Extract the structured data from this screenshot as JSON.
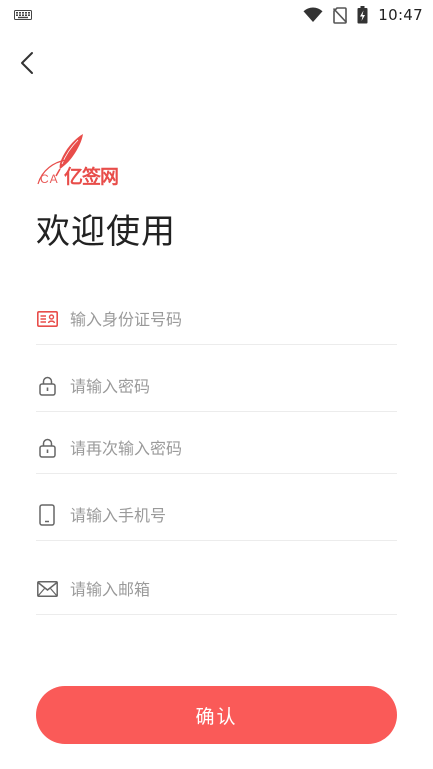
{
  "status_bar": {
    "time": "10:47",
    "icons": [
      "keyboard-icon",
      "wifi-icon",
      "no-sim-icon",
      "battery-charging-icon"
    ]
  },
  "header": {
    "back_icon": "chevron-left-icon"
  },
  "logo": {
    "ca_text": "CA",
    "brand_text": "亿签网",
    "icon": "quill-feather-icon",
    "color": "#e84d4a"
  },
  "title": "欢迎使用",
  "form": {
    "id_card": {
      "placeholder": "输入身份证号码",
      "icon": "id-card-icon"
    },
    "password": {
      "placeholder": "请输入密码",
      "icon": "lock-icon"
    },
    "confirm_password": {
      "placeholder": "请再次输入密码",
      "icon": "lock-icon"
    },
    "phone": {
      "placeholder": "请输入手机号",
      "icon": "phone-icon"
    },
    "email": {
      "placeholder": "请输入邮箱",
      "icon": "envelope-icon"
    }
  },
  "confirm_button": {
    "label": "确认",
    "color": "#fa5a58"
  }
}
